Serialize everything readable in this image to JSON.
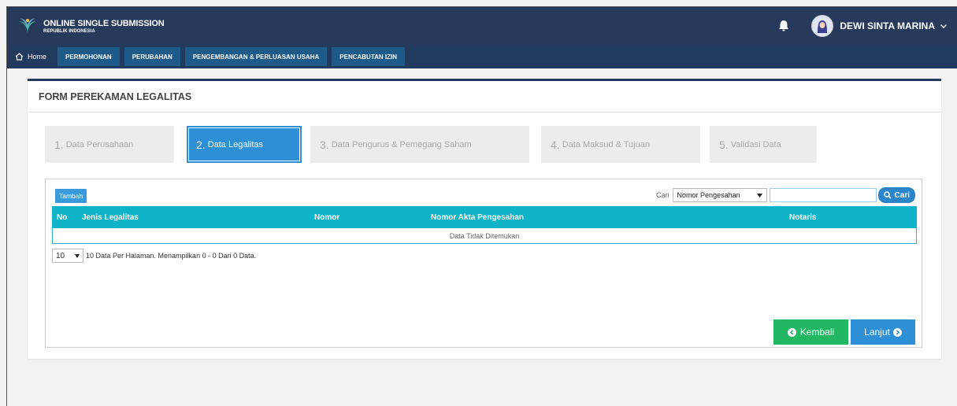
{
  "header": {
    "app_title": "ONLINE SINGLE SUBMISSION",
    "app_subtitle": "REPUBLIK INDONESIA",
    "user_name": "DEWI SINTA MARINA",
    "icons": [
      "logo-icon",
      "bell-icon",
      "avatar",
      "chevron-down-icon"
    ]
  },
  "nav": {
    "home_label": "Home",
    "items": [
      "PERMOHONAN",
      "PERUBAHAN",
      "PENGEMBANGAN & PERLUASAN USAHA",
      "PENCABUTAN IZIN"
    ]
  },
  "form": {
    "title": "FORM PEREKAMAN LEGALITAS",
    "steps": [
      {
        "num": "1.",
        "label": "Data Perusahaan"
      },
      {
        "num": "2.",
        "label": "Data Legalitas"
      },
      {
        "num": "3.",
        "label": "Data Pengurus & Pemegang Saham"
      },
      {
        "num": "4.",
        "label": "Data Maksud & Tujuan"
      },
      {
        "num": "5.",
        "label": "Validasi Data"
      }
    ],
    "active_step": 2
  },
  "table": {
    "add_button": "Tambah",
    "search_label": "Cari",
    "search_field_selected": "Nomor Pengesahan",
    "search_value": "",
    "search_button": "Cari",
    "columns": [
      "No",
      "Jenis Legalitas",
      "Nomor",
      "Nomor Akta Pengesahan",
      "Notaris"
    ],
    "empty_message": "Data Tidak Ditemukan",
    "page_size": "10",
    "pager_text": "10 Data Per Halaman. Menampilkan 0 - 0 Dari 0 Data."
  },
  "actions": {
    "back_label": "Kembali",
    "next_label": "Lanjut"
  },
  "colors": {
    "topbar": "#273a5c",
    "nav_item": "#1e5a8a",
    "table_header": "#0fb4c8",
    "active_step": "#2d8fd5",
    "back_button": "#22b863",
    "next_button": "#2d8fd5"
  }
}
